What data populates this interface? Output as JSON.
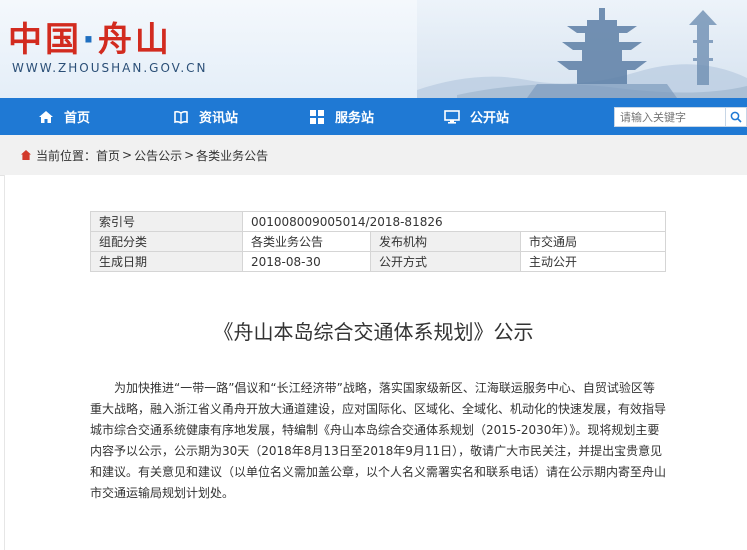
{
  "header": {
    "site_title_part1": "中国",
    "site_title_dot": "·",
    "site_title_part2": "舟山",
    "site_url": "WWW.ZHOUSHAN.GOV.CN"
  },
  "nav": {
    "items": [
      {
        "label": "首页",
        "icon": "home-icon"
      },
      {
        "label": "资讯站",
        "icon": "book-icon"
      },
      {
        "label": "服务站",
        "icon": "grid-icon"
      },
      {
        "label": "公开站",
        "icon": "monitor-icon"
      }
    ],
    "search_placeholder": "请输入关键字"
  },
  "breadcrumb": {
    "prefix": "当前位置：",
    "items": [
      "首页",
      "公告公示",
      "各类业务公告"
    ],
    "separator": ">"
  },
  "meta": {
    "index_label": "索引号",
    "index_value": "001008009005014/2018-81826",
    "category_label": "组配分类",
    "category_value": "各类业务公告",
    "publisher_label": "发布机构",
    "publisher_value": "市交通局",
    "date_label": "生成日期",
    "date_value": "2018-08-30",
    "mode_label": "公开方式",
    "mode_value": "主动公开"
  },
  "article": {
    "title": "《舟山本岛综合交通体系规划》公示",
    "body": "为加快推进“一带一路”倡议和“长江经济带”战略，落实国家级新区、江海联运服务中心、自贸试验区等重大战略，融入浙江省义甬舟开放大通道建设，应对国际化、区域化、全域化、机动化的快速发展，有效指导城市综合交通系统健康有序地发展，特编制《舟山本岛综合交通体系规划（2015-2030年）》。现将规划主要内容予以公示，公示期为30天（2018年8月13日至2018年9月11日），敬请广大市民关注，并提出宝贵意见和建议。有关意见和建议（以单位名义需加盖公章，以个人名义需署实名和联系电话）请在公示期内寄至舟山市交通运输局规划计划处。"
  }
}
